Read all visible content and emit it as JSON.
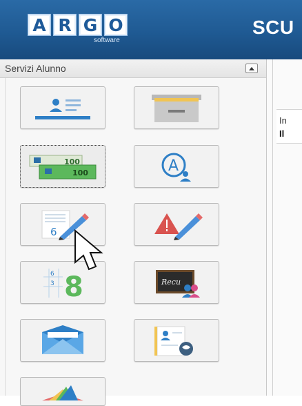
{
  "header": {
    "logo_letters": [
      "A",
      "R",
      "G",
      "O"
    ],
    "logo_subtitle": "software",
    "title": "SCU"
  },
  "panel": {
    "title": "Servizi Alunno"
  },
  "tiles": [
    {
      "icon": "student-card-icon"
    },
    {
      "icon": "file-cabinet-icon"
    },
    {
      "icon": "fee-payments-icon",
      "selected": true,
      "labels": [
        "100",
        "100"
      ]
    },
    {
      "icon": "absences-icon"
    },
    {
      "icon": "grades-icon",
      "digit": "6"
    },
    {
      "icon": "notes-warning-icon"
    },
    {
      "icon": "scores-icon",
      "digits": [
        "6",
        "3",
        "8"
      ]
    },
    {
      "icon": "recovery-icon",
      "board_text": "Recu"
    },
    {
      "icon": "messages-icon"
    },
    {
      "icon": "curriculum-icon"
    },
    {
      "icon": "colorful-fan-icon"
    }
  ],
  "main": {
    "text_line1": "In",
    "text_line2": "Il"
  },
  "colors": {
    "header_blue": "#1f5a93",
    "accent_blue": "#2e7fc6",
    "green": "#5cb85c",
    "red": "#d9534f"
  }
}
